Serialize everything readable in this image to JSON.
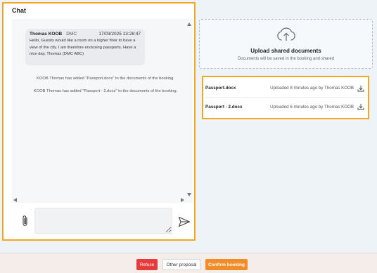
{
  "chat": {
    "title": "Chat",
    "messages": [
      {
        "author": "Thomas KOOB",
        "role": "DMC",
        "timestamp": "17/03/2025 13:28:47",
        "text": "Hello, Guests would like a room on a higher floor to have a view of the city. I am therefore enclosing passports. Have a nice day, Thomas (DMC ABC)"
      }
    ],
    "system_notes": [
      "KOOB Thomas has added \"Passport.docx\" to the documents of the booking.",
      "KOOB Thomas has added \"Passport - 2.docx\" to the documents of the booking."
    ],
    "input": {
      "value": "",
      "placeholder": ""
    }
  },
  "upload": {
    "title": "Upload shared documents",
    "subtitle": "Documents will be saved in the booking and shared"
  },
  "documents": [
    {
      "name": "Passport.docx",
      "meta": "Uploaded 8 minutes ago by Thomas KOOB"
    },
    {
      "name": "Passport - 2.docx",
      "meta": "Uploaded 6 minutes ago by Thomas KOOB"
    }
  ],
  "footer": {
    "refuse_label": "Refuse",
    "other_label": "Other proposal",
    "confirm_label": "Confirm booking"
  },
  "colors": {
    "accent_orange": "#f28c28",
    "highlight_border": "#f5a623",
    "refuse_red": "#e63b3b"
  },
  "icons": [
    "paperclip-icon",
    "send-icon",
    "cloud-upload-icon",
    "download-icon"
  ]
}
